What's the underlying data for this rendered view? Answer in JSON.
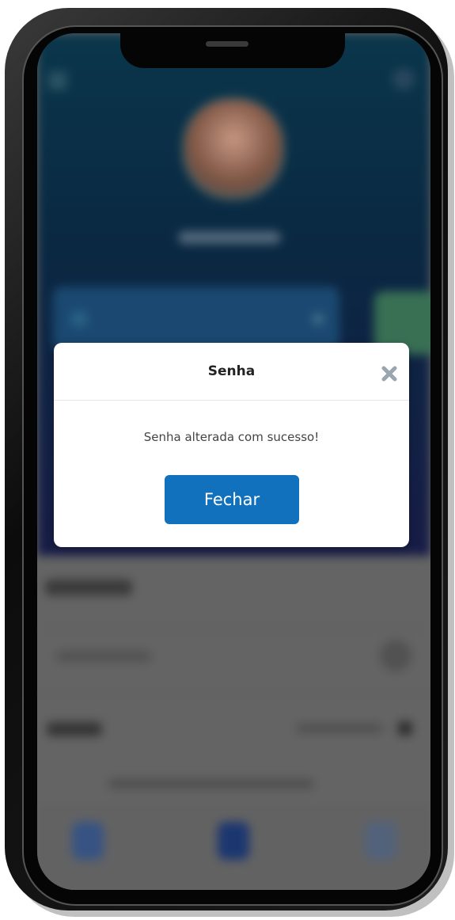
{
  "modal": {
    "title": "Senha",
    "message": "Senha alterada com sucesso!",
    "close_button_label": "Fechar",
    "close_icon": "close-x-icon"
  },
  "colors": {
    "primary_button": "#1271bd",
    "header_gradient_top": "#0b3b52",
    "header_gradient_bottom": "#1a1f4d",
    "close_icon": "#9aa5ad"
  }
}
